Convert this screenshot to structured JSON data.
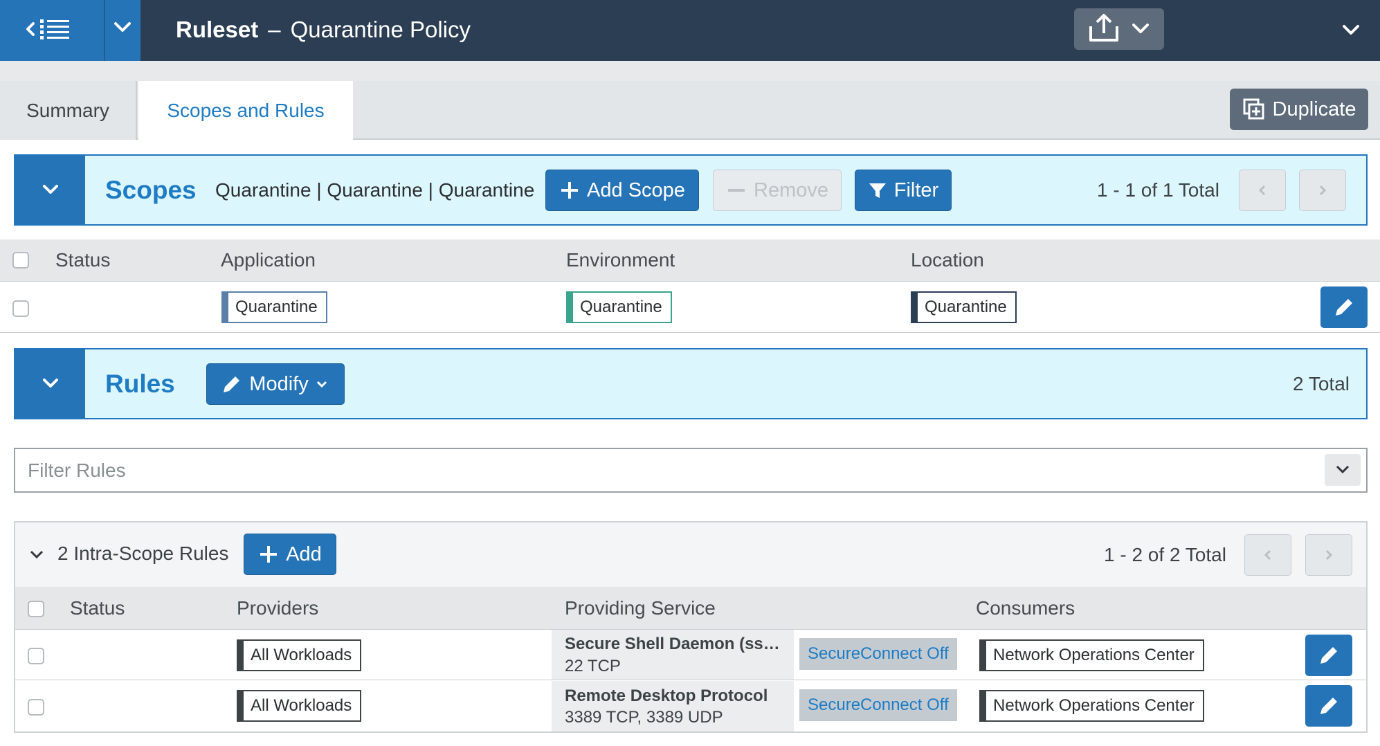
{
  "header": {
    "ruleset_label": "Ruleset",
    "separator": "–",
    "ruleset_name": "Quarantine Policy"
  },
  "tabs": [
    {
      "label": "Summary",
      "active": false
    },
    {
      "label": "Scopes and Rules",
      "active": true
    }
  ],
  "toolbar": {
    "duplicate_label": "Duplicate"
  },
  "scopes": {
    "title": "Scopes",
    "summary": "Quarantine | Quarantine | Quarantine",
    "add_label": "Add Scope",
    "remove_label": "Remove",
    "filter_label": "Filter",
    "pagination": "1 - 1 of 1 Total",
    "columns": [
      "Status",
      "Application",
      "Environment",
      "Location"
    ],
    "rows": [
      {
        "application": "Quarantine",
        "environment": "Quarantine",
        "location": "Quarantine"
      }
    ]
  },
  "rules": {
    "title": "Rules",
    "modify_label": "Modify",
    "total": "2 Total",
    "filter_placeholder": "Filter Rules",
    "intra_scope": {
      "title": "2 Intra-Scope Rules",
      "add_label": "Add",
      "pagination": "1 - 2 of 2 Total",
      "columns": [
        "Status",
        "Providers",
        "Providing Service",
        "Consumers"
      ],
      "rows": [
        {
          "provider": "All Workloads",
          "service_name": "Secure Shell Daemon (ss…",
          "service_ports": "22 TCP",
          "secure_connect": "SecureConnect Off",
          "consumer": "Network Operations Center"
        },
        {
          "provider": "All Workloads",
          "service_name": "Remote Desktop Protocol",
          "service_ports": "3389 TCP, 3389 UDP",
          "secure_connect": "SecureConnect Off",
          "consumer": "Network Operations Center"
        }
      ]
    }
  },
  "label_colors": {
    "application": "#5a7fa8",
    "environment": "#3aa58c",
    "location": "#2c3e53",
    "workload": "#3d4345",
    "consumer": "#3d4345"
  },
  "colors": {
    "accent": "#2574b8",
    "header": "#2c3e53",
    "section_bg": "#dcf6fd"
  }
}
